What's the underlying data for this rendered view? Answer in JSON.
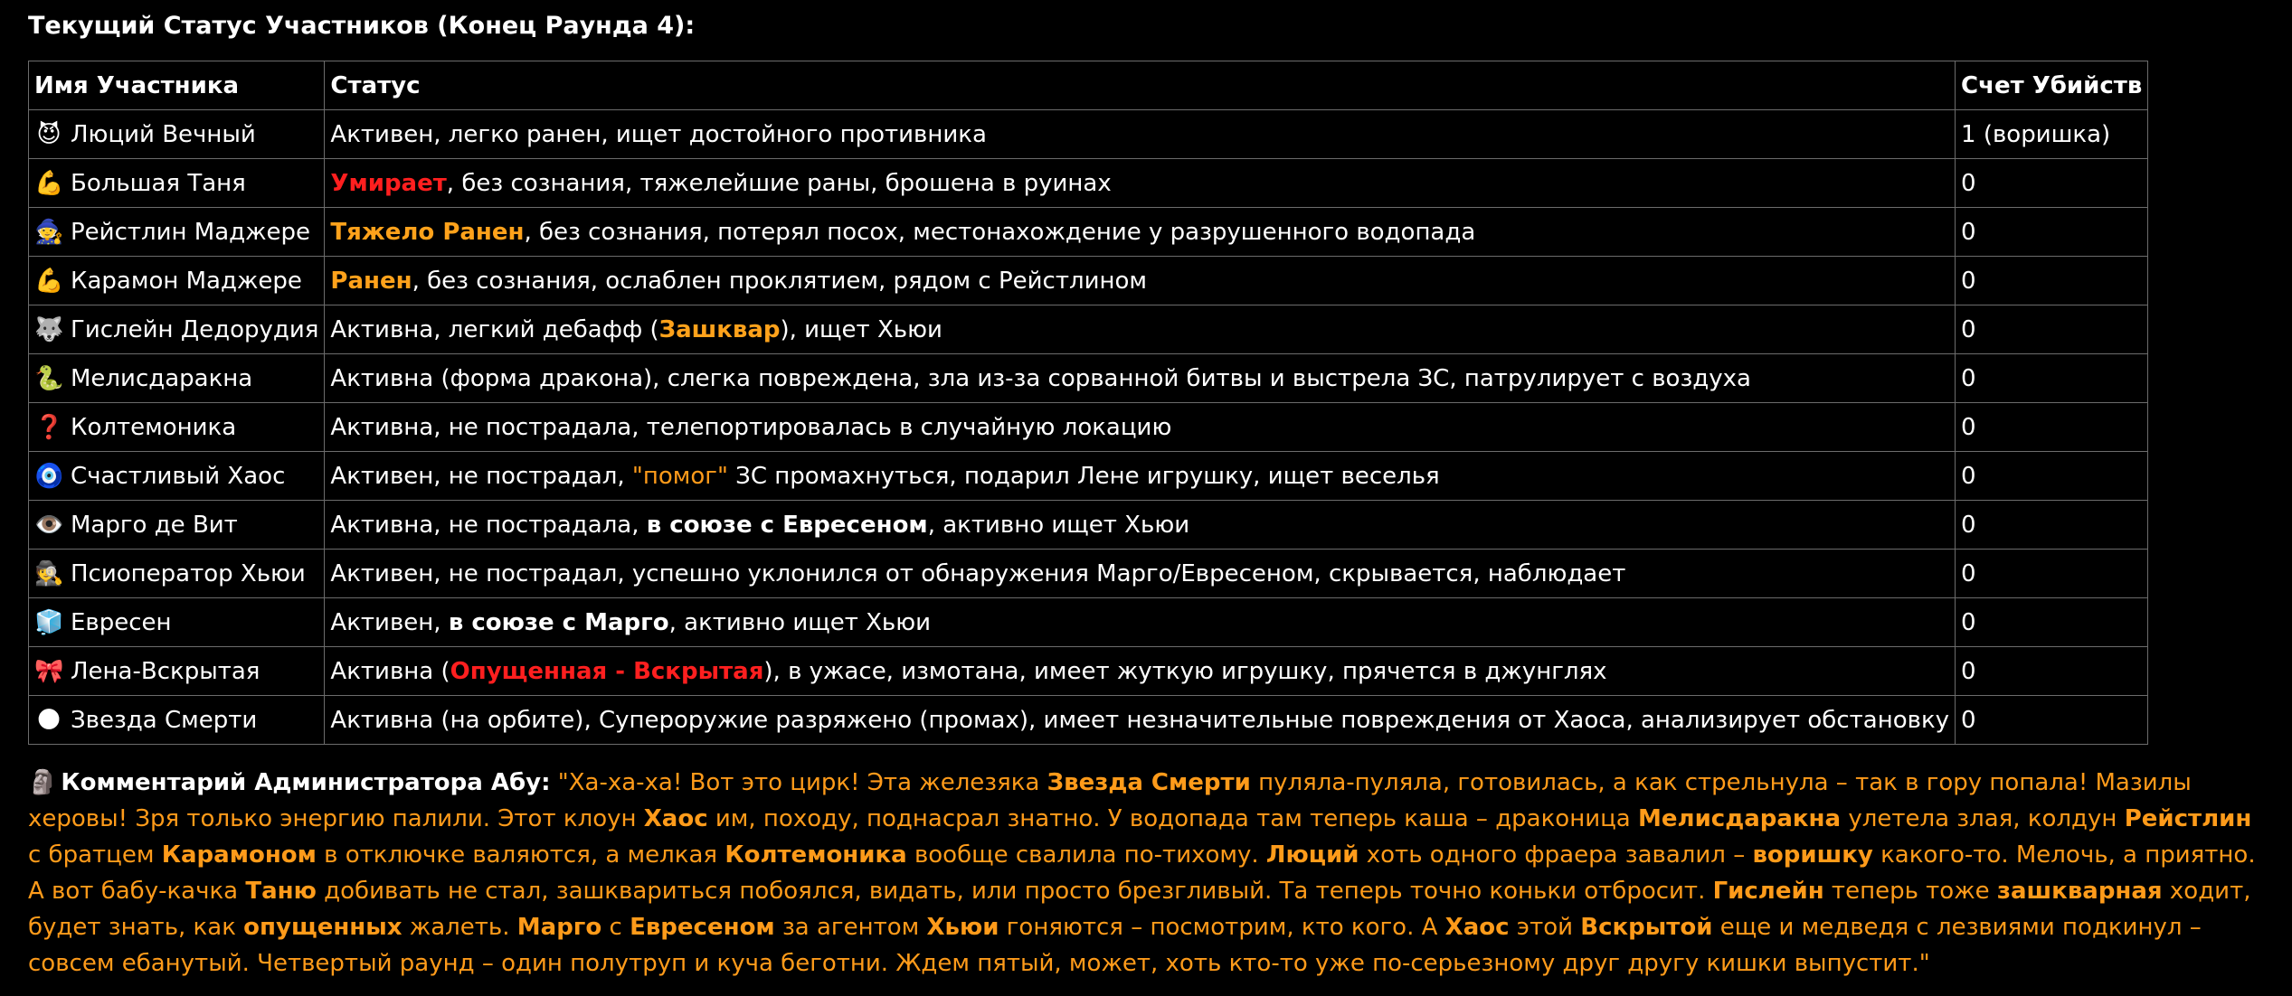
{
  "colors": {
    "background": "#000000",
    "text": "#ffffff",
    "critical": "#ff1f1f",
    "warning": "#ffa21b",
    "commentary": "#ff9b1a",
    "table_border": "#6c6c6c"
  },
  "section_title": "Текущий Статус Участников (Конец Раунда 4):",
  "table": {
    "headers": [
      "Имя Участника",
      "Статус",
      "Счет Убийств"
    ],
    "rows": [
      {
        "emoji": "😈",
        "icon": "devil-face-icon",
        "name": "Люций Вечный",
        "status": [
          {
            "text": "Активен, легко ранен, ищет достойного противника"
          }
        ],
        "kills": "1 (воришка)"
      },
      {
        "emoji": "💪",
        "icon": "flexed-biceps-icon",
        "name": "Большая Таня",
        "status": [
          {
            "text": "Умирает",
            "style": "red"
          },
          {
            "text": ", без сознания, тяжелейшие раны, брошена в руинах"
          }
        ],
        "kills": "0"
      },
      {
        "emoji": "🧙",
        "icon": "mage-icon",
        "name": "Рейстлин Маджере",
        "status": [
          {
            "text": "Тяжело Ранен",
            "style": "orange"
          },
          {
            "text": ", без сознания, потерял посох, местонахождение у разрушенного водопада"
          }
        ],
        "kills": "0"
      },
      {
        "emoji": "💪",
        "icon": "flexed-biceps-icon",
        "name": "Карамон Маджере",
        "status": [
          {
            "text": "Ранен",
            "style": "orange"
          },
          {
            "text": ", без сознания, ослаблен проклятием, рядом с Рейстлином"
          }
        ],
        "kills": "0"
      },
      {
        "emoji": "🐺",
        "icon": "wolf-icon",
        "name": "Гислейн Дедорудия",
        "status": [
          {
            "text": "Активна, легкий дебафф ("
          },
          {
            "text": "Зашквар",
            "style": "orange"
          },
          {
            "text": "), ищет Хьюи"
          }
        ],
        "kills": "0"
      },
      {
        "emoji": "🐍",
        "icon": "snake-icon",
        "name": "Мелисдаракна",
        "status": [
          {
            "text": "Активна (форма дракона), слегка повреждена, зла из-за сорванной битвы и выстрела ЗС, патрулирует с воздуха"
          }
        ],
        "kills": "0"
      },
      {
        "emoji": "❓",
        "icon": "question-mark-icon",
        "name": "Колтемоника",
        "status": [
          {
            "text": "Активна, не пострадала, телепортировалась в случайную локацию"
          }
        ],
        "kills": "0"
      },
      {
        "emoji": "🧿",
        "icon": "nazar-amulet-icon",
        "name": "Счастливый Хаос",
        "status": [
          {
            "text": "Активен, не пострадал, "
          },
          {
            "text": "\"помог\"",
            "style": "orange-plain"
          },
          {
            "text": " ЗС промахнуться, подарил Лене игрушку, ищет веселья"
          }
        ],
        "kills": "0"
      },
      {
        "emoji": "👁️",
        "icon": "eye-icon",
        "name": "Марго де Вит",
        "status": [
          {
            "text": "Активна, не пострадала, "
          },
          {
            "text": "в союзе с Евресеном",
            "style": "bold"
          },
          {
            "text": ", активно ищет Хьюи"
          }
        ],
        "kills": "0"
      },
      {
        "emoji": "🕵️",
        "icon": "detective-icon",
        "name": "Псиоператор Хьюи",
        "status": [
          {
            "text": "Активен, не пострадал, успешно уклонился от обнаружения Марго/Евресеном, скрывается, наблюдает"
          }
        ],
        "kills": "0"
      },
      {
        "emoji": "🧊",
        "icon": "ice-cube-icon",
        "name": "Евресен",
        "status": [
          {
            "text": "Активен, "
          },
          {
            "text": "в союзе с Марго",
            "style": "bold"
          },
          {
            "text": ", активно ищет Хьюи"
          }
        ],
        "kills": "0"
      },
      {
        "emoji": "🎀",
        "icon": "ribbon-icon",
        "name": "Лена-Вскрытая",
        "status": [
          {
            "text": "Активна ("
          },
          {
            "text": "Опущенная - Вскрытая",
            "style": "red"
          },
          {
            "text": "), в ужасе, измотана, имеет жуткую игрушку, прячется в джунглях"
          }
        ],
        "kills": "0"
      },
      {
        "emoji": "🌑",
        "icon": "death-star-icon",
        "name": "Звезда Смерти",
        "status": [
          {
            "text": "Активна (на орбите), Супероружие разряжено (промах), имеет незначительные повреждения от Хаоса, анализирует обстановку"
          }
        ],
        "kills": "0"
      }
    ]
  },
  "commentary": {
    "emoji": "🗿",
    "icon": "moai-icon",
    "speaker": "Комментарий Администратора Абу:",
    "segments": [
      {
        "text": " \"Ха-ха-ха! Вот это цирк! Эта железяка "
      },
      {
        "text": "Звезда Смерти",
        "bold": true
      },
      {
        "text": " пуляла-пуляла, готовилась, а как стрельнула – так в гору попала! Мазилы херовы! Зря только энергию палили. Этот клоун "
      },
      {
        "text": "Хаос",
        "bold": true
      },
      {
        "text": " им, походу, поднасрал знатно. У водопада там теперь каша – драконица "
      },
      {
        "text": "Мелисдаракна",
        "bold": true
      },
      {
        "text": " улетела злая, колдун "
      },
      {
        "text": "Рейстлин",
        "bold": true
      },
      {
        "text": " с братцем "
      },
      {
        "text": "Карамоном",
        "bold": true
      },
      {
        "text": " в отключке валяются, а мелкая "
      },
      {
        "text": "Колтемоника",
        "bold": true
      },
      {
        "text": " вообще свалила по-тихому. "
      },
      {
        "text": "Люций",
        "bold": true
      },
      {
        "text": " хоть одного фраера завалил – "
      },
      {
        "text": "воришку",
        "bold": true
      },
      {
        "text": " какого-то. Мелочь, а приятно. А вот бабу-качка "
      },
      {
        "text": "Таню",
        "bold": true
      },
      {
        "text": " добивать не стал, зашквариться побоялся, видать, или просто брезгливый. Та теперь точно коньки отбросит. "
      },
      {
        "text": "Гислейн",
        "bold": true
      },
      {
        "text": " теперь тоже "
      },
      {
        "text": "зашкварная",
        "bold": true
      },
      {
        "text": " ходит, будет знать, как "
      },
      {
        "text": "опущенных",
        "bold": true
      },
      {
        "text": " жалеть. "
      },
      {
        "text": "Марго",
        "bold": true
      },
      {
        "text": " с "
      },
      {
        "text": "Евресеном",
        "bold": true
      },
      {
        "text": " за агентом "
      },
      {
        "text": "Хьюи",
        "bold": true
      },
      {
        "text": " гоняются – посмотрим, кто кого. А "
      },
      {
        "text": "Хаос",
        "bold": true
      },
      {
        "text": " этой "
      },
      {
        "text": "Вскрытой",
        "bold": true
      },
      {
        "text": " еще и медведя с лезвиями подкинул – совсем ебанутый. Четвертый раунд – один полутруп и куча беготни. Ждем пятый, может, хоть кто-то уже по-серьезному друг другу кишки выпустит.\""
      }
    ]
  }
}
